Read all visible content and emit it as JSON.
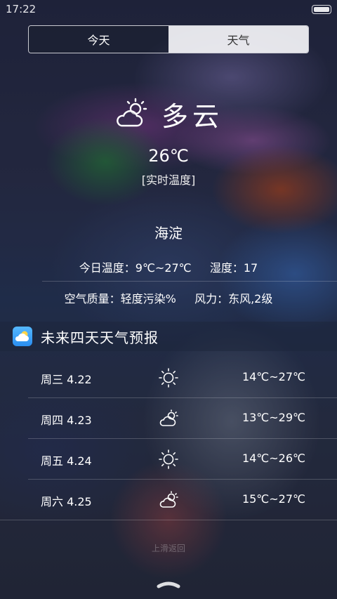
{
  "status_bar": {
    "time": "17:22"
  },
  "tabs": [
    {
      "label": "今天",
      "active": true
    },
    {
      "label": "天气",
      "active": false
    }
  ],
  "current": {
    "condition": "多云",
    "condition_icon": "partly-cloudy-icon",
    "temperature": "26℃",
    "temperature_note": "[实时温度]",
    "city": "海淀",
    "temp_range": "今日温度：9℃~27℃",
    "humidity": "湿度：17",
    "air_quality": "空气质量：轻度污染%",
    "wind": "风力：东风,2级"
  },
  "forecast": {
    "title": "未来四天天气预报",
    "days": [
      {
        "label": "周三 4.22",
        "icon": "sunny-icon",
        "range": "14℃~27℃"
      },
      {
        "label": "周四 4.23",
        "icon": "partly-cloudy-icon",
        "range": "13℃~29℃"
      },
      {
        "label": "周五 4.24",
        "icon": "sunny-icon",
        "range": "14℃~26℃"
      },
      {
        "label": "周六 4.25",
        "icon": "partly-cloudy-icon",
        "range": "15℃~27℃"
      }
    ]
  },
  "footer": {
    "swipe_hint": "上滑返回"
  },
  "colors": {
    "tab_active_bg": "#232842",
    "tab_inactive_bg": "#f5f5f8",
    "app_icon": "#2a8ef0"
  }
}
